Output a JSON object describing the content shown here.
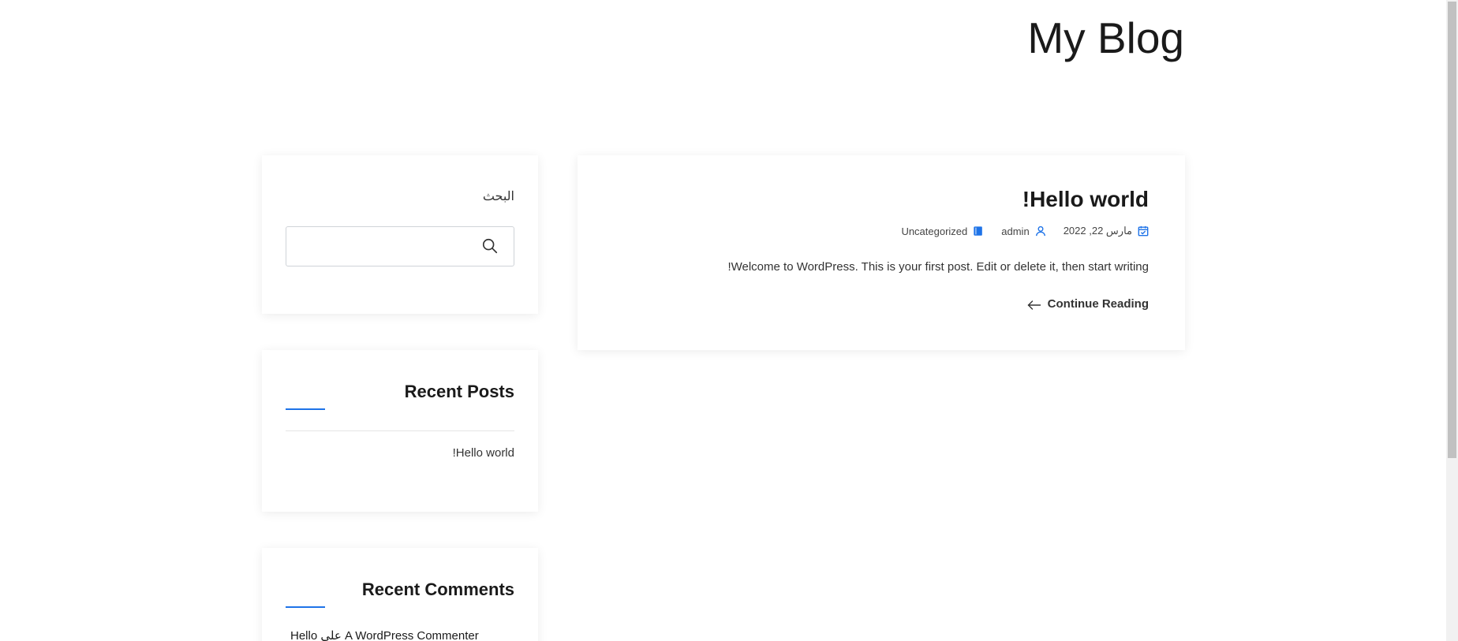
{
  "site": {
    "title": "My Blog"
  },
  "sidebar": {
    "search": {
      "title": "البحث",
      "placeholder": ""
    },
    "recent_posts": {
      "title": "Recent Posts",
      "items": [
        {
          "label": "!Hello world"
        }
      ]
    },
    "recent_comments": {
      "title": "Recent Comments",
      "items": [
        {
          "label": "Hello على A WordPress Commenter"
        }
      ]
    }
  },
  "post": {
    "title": "!Hello world",
    "date": "مارس 22, 2022",
    "author": "admin",
    "category": "Uncategorized",
    "excerpt": "!Welcome to WordPress. This is your first post. Edit or delete it, then start writing",
    "continue_label": "Continue Reading"
  },
  "colors": {
    "accent": "#1e73e8",
    "title": "#1a1a1a",
    "text": "#333333"
  },
  "icons": {
    "search": "search-icon",
    "date": "calendar-check-icon",
    "author": "user-icon",
    "category": "folder-icon",
    "continue": "arrow-left-icon"
  }
}
